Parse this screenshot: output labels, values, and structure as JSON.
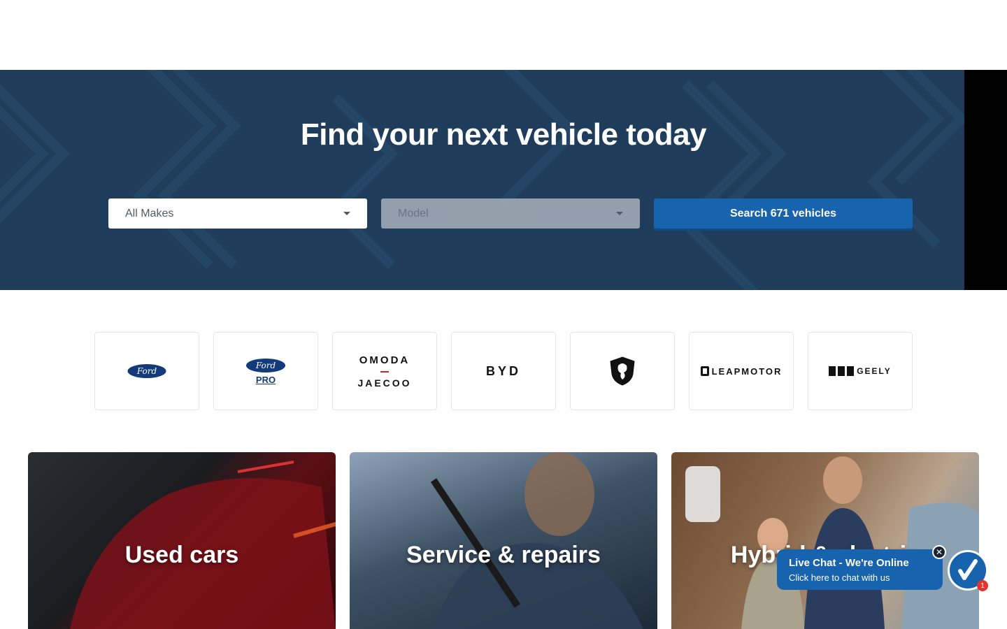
{
  "hero": {
    "title": "Find your next vehicle today",
    "makes_select": "All Makes",
    "model_select": "Model",
    "search_label": "Search 671 vehicles"
  },
  "brands": [
    {
      "name": "Ford",
      "logo_text": "Ford"
    },
    {
      "name": "Ford Pro",
      "logo_text": "Ford",
      "sub_text": "PRO"
    },
    {
      "name": "Omoda Jaecoo",
      "logo_text": "OMODA",
      "sub_text": "JAECOO"
    },
    {
      "name": "BYD",
      "logo_text": "BYD"
    },
    {
      "name": "Peugeot",
      "logo_text": ""
    },
    {
      "name": "Leapmotor",
      "logo_text": "LEAPMOTOR"
    },
    {
      "name": "Geely",
      "logo_text": "GEELY"
    }
  ],
  "cards": [
    {
      "label": "Used cars"
    },
    {
      "label": "Service & repairs"
    },
    {
      "label": "Hybrid & electric"
    }
  ],
  "chat": {
    "title": "Live Chat - We're Online",
    "subtitle": "Click here to chat with us",
    "badge_count": "1"
  },
  "colors": {
    "hero_bg": "#1f3d5a",
    "accent": "#1763ad",
    "ford_blue": "#133a7c"
  }
}
